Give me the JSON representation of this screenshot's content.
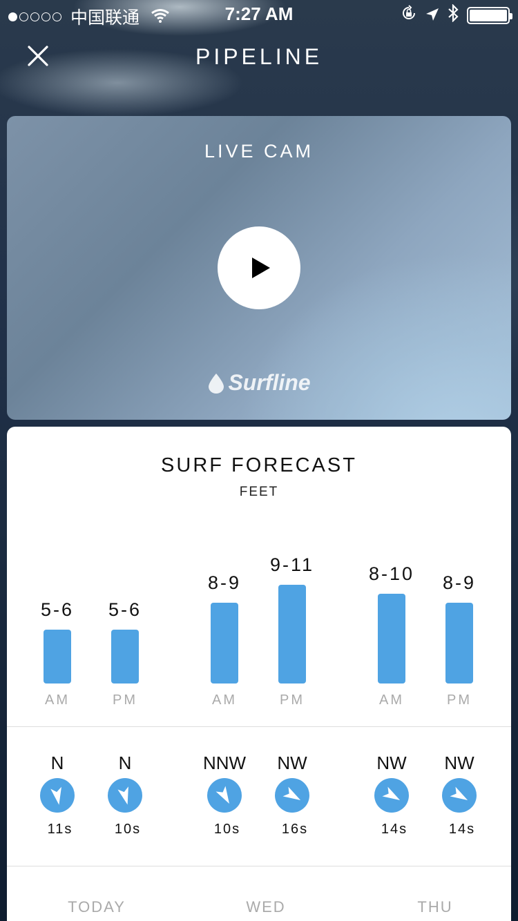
{
  "status_bar": {
    "carrier": "中国联通",
    "time": "7:27 AM"
  },
  "header": {
    "title": "PIPELINE"
  },
  "live_cam": {
    "title": "LIVE CAM",
    "logo_text": "Surfline"
  },
  "forecast": {
    "title": "SURF FORECAST",
    "unit": "FEET",
    "slots": [
      {
        "height": "5-6",
        "max_ft": 6,
        "ampm": "AM",
        "direction": "N",
        "rotation_deg": 170,
        "period": "11s"
      },
      {
        "height": "5-6",
        "max_ft": 6,
        "ampm": "PM",
        "direction": "N",
        "rotation_deg": 165,
        "period": "10s"
      },
      {
        "height": "8-9",
        "max_ft": 9,
        "ampm": "AM",
        "direction": "NNW",
        "rotation_deg": 150,
        "period": "10s"
      },
      {
        "height": "9-11",
        "max_ft": 11,
        "ampm": "PM",
        "direction": "NW",
        "rotation_deg": 120,
        "period": "16s"
      },
      {
        "height": "8-10",
        "max_ft": 10,
        "ampm": "AM",
        "direction": "NW",
        "rotation_deg": 120,
        "period": "14s"
      },
      {
        "height": "8-9",
        "max_ft": 9,
        "ampm": "PM",
        "direction": "NW",
        "rotation_deg": 120,
        "period": "14s"
      }
    ],
    "days": [
      "TODAY",
      "WED",
      "THU"
    ]
  },
  "colors": {
    "accent": "#4fa3e3"
  }
}
